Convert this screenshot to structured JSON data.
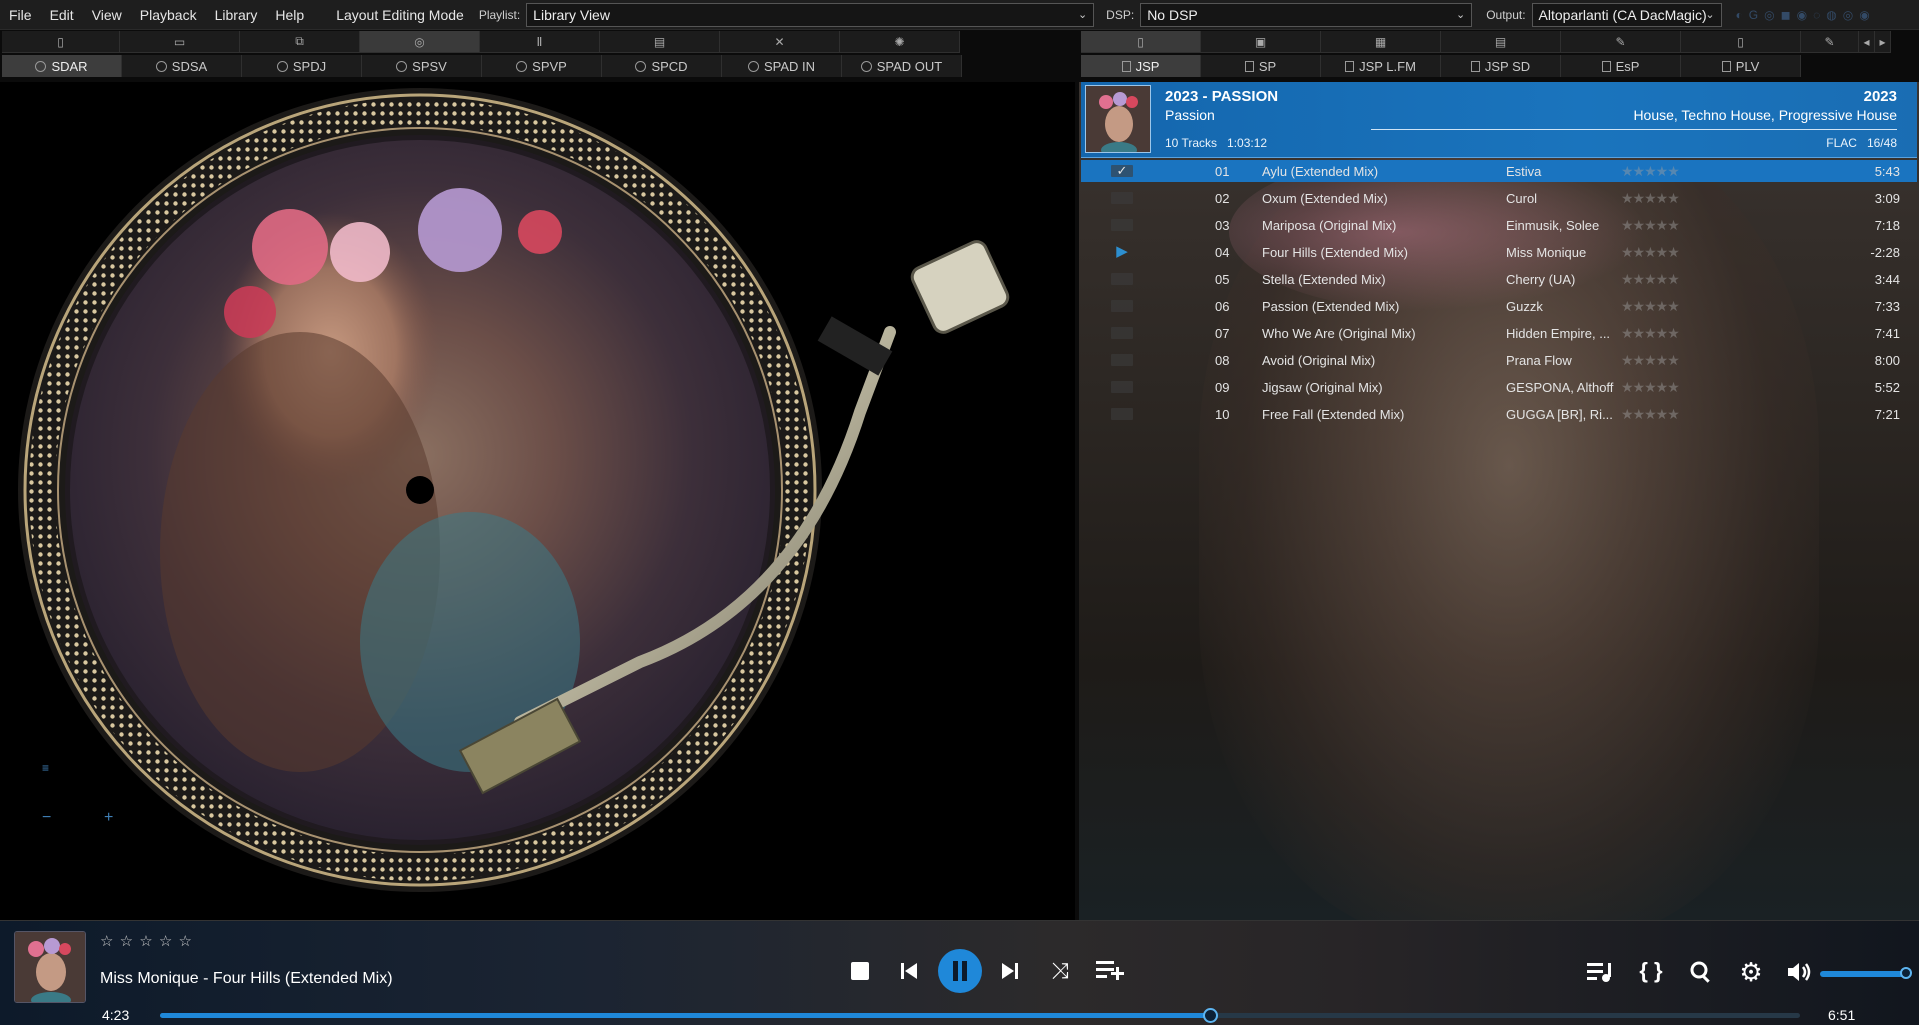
{
  "menu": {
    "items": [
      "File",
      "Edit",
      "View",
      "Playback",
      "Library",
      "Help"
    ],
    "layout_mode": "Layout Editing Mode"
  },
  "playlist": {
    "label": "Playlist:",
    "value": "Library View"
  },
  "dsp": {
    "label": "DSP:",
    "value": "No DSP"
  },
  "output": {
    "label": "Output:",
    "value": "Altoparlanti (CA DacMagic)"
  },
  "left_tabs": [
    "SDAR",
    "SDSA",
    "SPDJ",
    "SPSV",
    "SPVP",
    "SPCD",
    "SPAD IN",
    "SPAD OUT"
  ],
  "right_tabs": [
    "JSP",
    "SP",
    "JSP L.FM",
    "JSP SD",
    "EsP",
    "PLV"
  ],
  "album": {
    "title": "2023 - PASSION",
    "subtitle": "Passion",
    "year": "2023",
    "genres": "House, Techno House, Progressive House",
    "tracks_info": "10 Tracks   1:03:12",
    "format": "FLAC   16/48"
  },
  "tracks": [
    {
      "num": "01",
      "title": "Aylu (Extended Mix)",
      "artist": "Estiva",
      "duration": "5:43",
      "state": "selected",
      "mark": "✓"
    },
    {
      "num": "02",
      "title": "Oxum (Extended Mix)",
      "artist": "Curol",
      "duration": "3:09",
      "state": "",
      "mark": ""
    },
    {
      "num": "03",
      "title": "Mariposa (Original Mix)",
      "artist": "Einmusik, Solee",
      "duration": "7:18",
      "state": "",
      "mark": ""
    },
    {
      "num": "04",
      "title": "Four Hills (Extended Mix)",
      "artist": "Miss Monique",
      "duration": "-2:28",
      "state": "playing",
      "mark": "▶"
    },
    {
      "num": "05",
      "title": "Stella (Extended Mix)",
      "artist": "Cherry (UA)",
      "duration": "3:44",
      "state": "",
      "mark": ""
    },
    {
      "num": "06",
      "title": "Passion (Extended Mix)",
      "artist": "Guzzk",
      "duration": "7:33",
      "state": "",
      "mark": ""
    },
    {
      "num": "07",
      "title": "Who We Are (Original Mix)",
      "artist": "Hidden Empire, ...",
      "duration": "7:41",
      "state": "",
      "mark": ""
    },
    {
      "num": "08",
      "title": "Avoid (Original Mix)",
      "artist": "Prana Flow",
      "duration": "8:00",
      "state": "",
      "mark": ""
    },
    {
      "num": "09",
      "title": "Jigsaw (Original Mix)",
      "artist": "GESPONA, Althoff",
      "duration": "5:52",
      "state": "",
      "mark": ""
    },
    {
      "num": "10",
      "title": "Free Fall (Extended Mix)",
      "artist": "GUGGA [BR], Ri...",
      "duration": "7:21",
      "state": "",
      "mark": ""
    }
  ],
  "rating_stars": "★★★★★",
  "now_playing": {
    "text": "Miss Monique - Four Hills (Extended Mix)",
    "rating": "☆ ☆ ☆ ☆ ☆",
    "elapsed": "4:23",
    "total": "6:51",
    "progress": 0.64,
    "volume": 1.0
  },
  "accent_color": "#1f88d9"
}
